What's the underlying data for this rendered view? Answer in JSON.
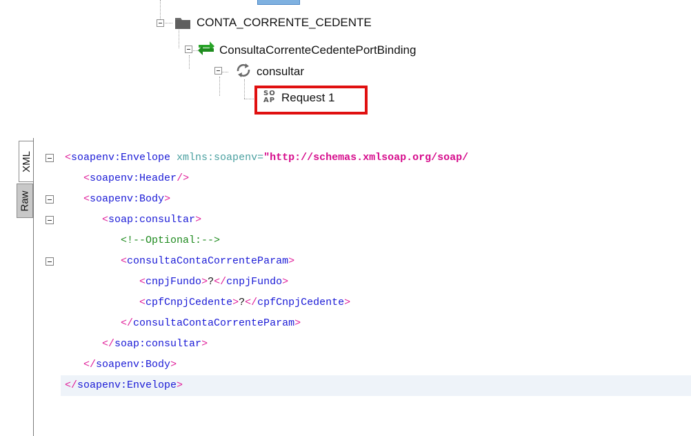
{
  "tree": {
    "top_item": "CONTA_CORRENTE_CEDENTE",
    "binding": "ConsultaCorrenteCedentePortBinding",
    "operation": "consultar",
    "request": "Request 1",
    "soap_icon_top": "SO",
    "soap_icon_bottom": "AP"
  },
  "editor": {
    "tabs": [
      "XML",
      "Raw"
    ],
    "active_tab": "XML",
    "lines": [
      {
        "open": "<",
        "tag": "soapenv:Envelope",
        "attr": " xmlns:soapenv=",
        "val": "\"http://schemas.xmlsoap.org/soap/"
      },
      {
        "indent": "   ",
        "open": "<",
        "tag": "soapenv:Header",
        "close": "/>"
      },
      {
        "indent": "   ",
        "open": "<",
        "tag": "soapenv:Body",
        "close": ">"
      },
      {
        "indent": "      ",
        "open": "<",
        "tag": "soap:consultar",
        "close": ">"
      },
      {
        "indent": "         ",
        "comment": "<!--Optional:-->"
      },
      {
        "indent": "         ",
        "open": "<",
        "tag": "consultaContaCorrenteParam",
        "close": ">"
      },
      {
        "indent": "            ",
        "open": "<",
        "tag": "cnpjFundo",
        "close": ">",
        "text": "?",
        "open2": "</",
        "tag2": "cnpjFundo",
        "close2": ">"
      },
      {
        "indent": "            ",
        "open": "<",
        "tag": "cpfCnpjCedente",
        "close": ">",
        "text": "?",
        "open2": "</",
        "tag2": "cpfCnpjCedente",
        "close2": ">"
      },
      {
        "indent": "         ",
        "open": "</",
        "tag": "consultaContaCorrenteParam",
        "close": ">"
      },
      {
        "indent": "      ",
        "open": "</",
        "tag": "soap:consultar",
        "close": ">"
      },
      {
        "indent": "   ",
        "open": "</",
        "tag": "soapenv:Body",
        "close": ">"
      },
      {
        "open": "</",
        "tag": "soapenv:Envelope",
        "close": ">"
      }
    ]
  },
  "colors": {
    "tag": "#1a1ad6",
    "bracket": "#e0209a",
    "attribute": "#4aa0a0",
    "value": "#d60c8c",
    "comment": "#1e8a1e",
    "highlight": "#e01010"
  }
}
